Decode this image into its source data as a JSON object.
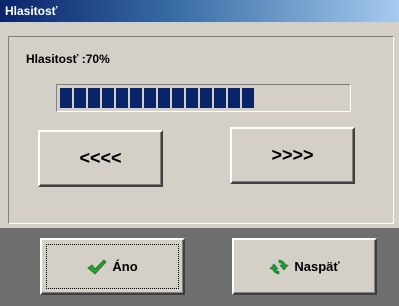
{
  "window": {
    "title": "Hlasitosť"
  },
  "volume": {
    "label": "Hlasitosť :70%",
    "level_percent": 70,
    "filled_segments": 14
  },
  "buttons": {
    "decrease_label": "<<<<",
    "increase_label": ">>>>",
    "ok_label": "Áno",
    "back_label": "Naspäť"
  },
  "icons": {
    "ok": "checkmark-icon",
    "back": "refresh-icon"
  },
  "colors": {
    "title_bar_start": "#0a246a",
    "title_bar_end": "#a6caf0",
    "progress_fill": "#0a246a",
    "check_green": "#2e9e2e",
    "refresh_green": "#1e9c3a",
    "bottom_bar": "#6f6f6f"
  }
}
